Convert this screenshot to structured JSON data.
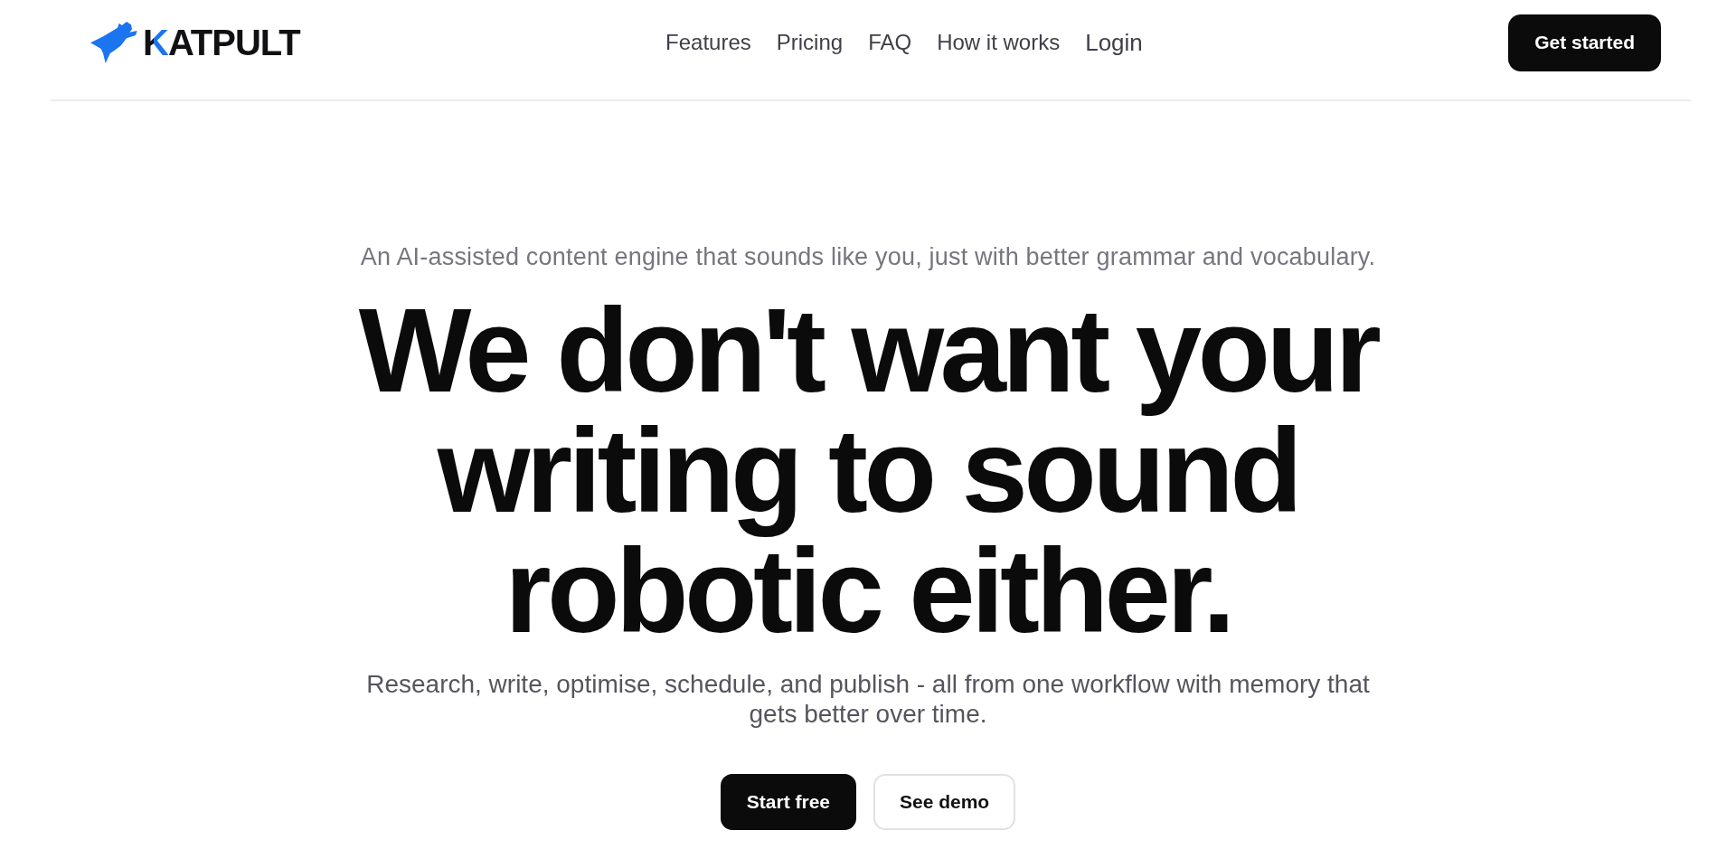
{
  "header": {
    "brand": "KATPULT",
    "nav": [
      "Features",
      "Pricing",
      "FAQ",
      "How it works"
    ],
    "login": "Login",
    "cta": "Get started"
  },
  "hero": {
    "eyebrow": "An AI-assisted content engine that sounds like you, just with better grammar and vocabulary.",
    "headline": "We don't want your writing to sound robotic either.",
    "subheadline": "Research, write, optimise, schedule, and publish - all from one workflow with memory that gets better over time.",
    "buttons": [
      {
        "label": "Start free",
        "kind": "primary"
      },
      {
        "label": "See demo",
        "kind": "secondary"
      }
    ]
  }
}
